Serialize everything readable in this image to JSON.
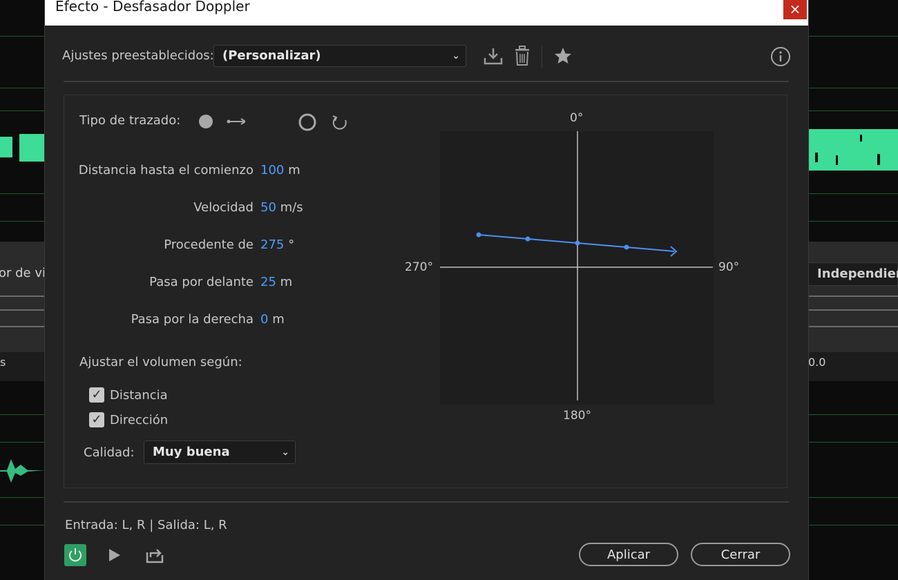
{
  "dialog": {
    "title": "Efecto - Desfasador Doppler",
    "close_label": "×"
  },
  "presets": {
    "label": "Ajustes preestablecidos:",
    "value": "(Personalizar)"
  },
  "path_type": {
    "label": "Tipo de trazado:"
  },
  "params": [
    {
      "label": "Distancia hasta el comienzo",
      "value": "100",
      "unit": "m"
    },
    {
      "label": "Velocidad",
      "value": "50",
      "unit": "m/s"
    },
    {
      "label": "Procedente de",
      "value": "275",
      "unit": "°"
    },
    {
      "label": "Pasa por delante",
      "value": "25",
      "unit": "m"
    },
    {
      "label": "Pasa por la derecha",
      "value": "0",
      "unit": "m"
    }
  ],
  "volume": {
    "label": "Ajustar el volumen según:",
    "distance_label": "Distancia",
    "direction_label": "Dirección",
    "distance_checked": true,
    "direction_checked": true
  },
  "quality": {
    "label": "Calidad:",
    "value": "Muy buena"
  },
  "graph": {
    "top": "0°",
    "right": "90°",
    "bottom": "180°",
    "left": "270°"
  },
  "io": {
    "text": "Entrada: L, R | Salida: L, R"
  },
  "buttons": {
    "apply": "Aplicar",
    "close": "Cerrar"
  },
  "background": {
    "left_text": "or de vi",
    "right_text": "Independient",
    "left_tick": "s",
    "right_tick": "0.0"
  },
  "colors": {
    "accent": "#4d9bff",
    "power": "#2f9e64",
    "waveform": "#3ddc97"
  }
}
